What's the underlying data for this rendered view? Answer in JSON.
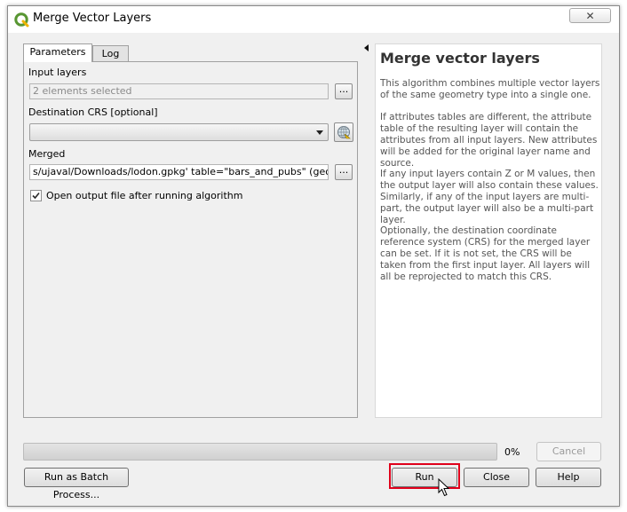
{
  "window": {
    "title": "Merge Vector Layers",
    "close_label": "✕"
  },
  "tabs": [
    {
      "label": "Parameters",
      "active": true
    },
    {
      "label": "Log",
      "active": false
    }
  ],
  "params": {
    "input_layers_label": "Input layers",
    "input_layers_value": "2 elements selected",
    "input_layers_btn": "...",
    "dest_crs_label": "Destination CRS [optional]",
    "dest_crs_value": "",
    "merged_label": "Merged",
    "merged_value": "s/ujaval/Downloads/lodon.gpkg' table=\"bars_and_pubs\" (geom) sql=",
    "merged_btn": "...",
    "open_output_label": "Open output file after running algorithm",
    "open_output_checked": true
  },
  "help": {
    "title": "Merge vector layers",
    "paragraphs": [
      "This algorithm combines multiple vector layers of the same geometry type into a single one.",
      "If attributes tables are different, the attribute table of the resulting layer will contain the attributes from all input layers. New attributes will be added for the original layer name and source.",
      "If any input layers contain Z or M values, then the output layer will also contain these values. Similarly, if any of the input layers are multi-part, the output layer will also be a multi-part layer.",
      "Optionally, the destination coordinate reference system (CRS) for the merged layer can be set. If it is not set, the CRS will be taken from the first input layer. All layers will all be reprojected to match this CRS."
    ]
  },
  "progress": {
    "value": 0,
    "label": "0%"
  },
  "buttons": {
    "cancel": "Cancel",
    "batch": "Run as Batch Process...",
    "run": "Run",
    "close": "Close",
    "help": "Help"
  },
  "icons": {
    "app": "qgis-logo-icon",
    "crs": "globe-icon",
    "collapse": "collapse-arrow-icon",
    "cursor": "mouse-pointer-icon"
  },
  "colors": {
    "highlight": "#e0001b",
    "qgis_green": "#589632",
    "qgis_yellow": "#f0b400"
  }
}
